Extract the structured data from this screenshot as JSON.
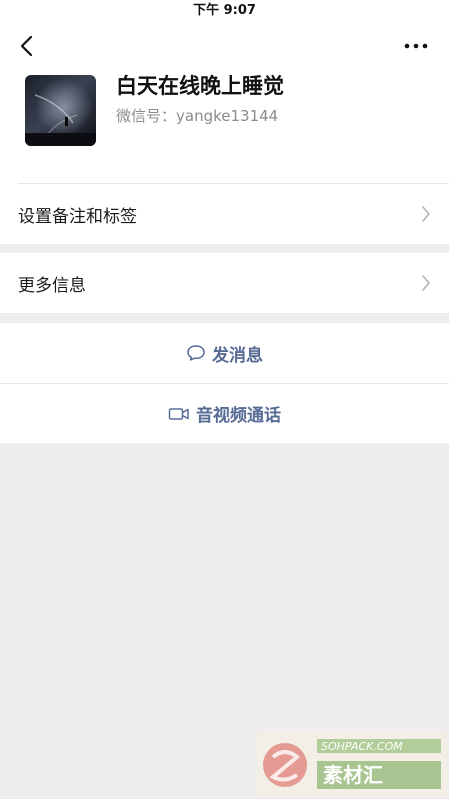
{
  "status_bar": {
    "time": "下午 9:07"
  },
  "nav": {
    "back_icon": "chevron-left-icon",
    "more_icon": "more-dots-icon"
  },
  "profile": {
    "nickname": "白天在线晚上睡觉",
    "wechat_id": "微信号：yangke13144"
  },
  "rows": {
    "remark_tags": "设置备注和标签",
    "more_info": "更多信息"
  },
  "actions": {
    "send_message": "发消息",
    "av_call": "音视频通话"
  },
  "colors": {
    "link": "#576b95",
    "background": "#ededed"
  },
  "watermark": {
    "site": "SOHPACK.COM",
    "brand": "素材汇"
  }
}
